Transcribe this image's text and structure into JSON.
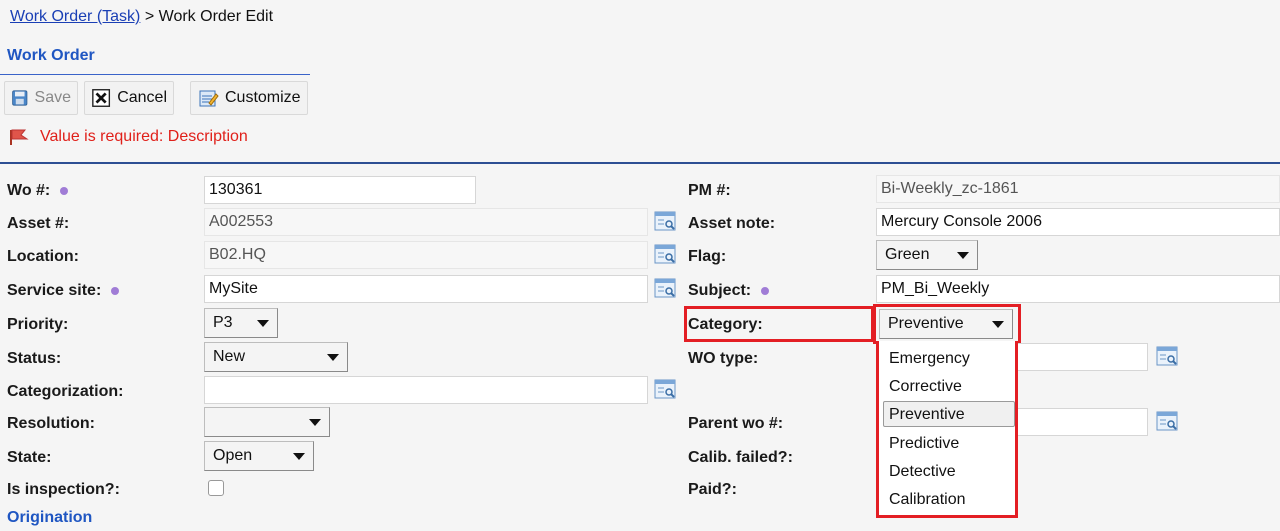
{
  "breadcrumb": {
    "link": "Work Order (Task)",
    "separator": ">",
    "current": "Work Order Edit"
  },
  "section": {
    "title": "Work Order"
  },
  "toolbar": {
    "save": "Save",
    "cancel": "Cancel",
    "customize": "Customize"
  },
  "error": {
    "message": "Value is required: Description"
  },
  "form": {
    "wo_num": {
      "label": "Wo #:",
      "value": "130361"
    },
    "asset_num": {
      "label": "Asset #:",
      "value": "A002553"
    },
    "location": {
      "label": "Location:",
      "value": "B02.HQ"
    },
    "service_site": {
      "label": "Service site:",
      "value": "MySite"
    },
    "priority": {
      "label": "Priority:",
      "value": "P3"
    },
    "status": {
      "label": "Status:",
      "value": "New"
    },
    "categorization": {
      "label": "Categorization:",
      "value": ""
    },
    "resolution": {
      "label": "Resolution:",
      "value": ""
    },
    "state": {
      "label": "State:",
      "value": "Open"
    },
    "is_inspection": {
      "label": "Is inspection?:",
      "checked": false
    },
    "pm_num": {
      "label": "PM #:",
      "value": "Bi-Weekly_zc-1861"
    },
    "asset_note": {
      "label": "Asset note:",
      "value": "Mercury Console 2006"
    },
    "flag": {
      "label": "Flag:",
      "value": "Green"
    },
    "subject": {
      "label": "Subject:",
      "value": "PM_Bi_Weekly"
    },
    "category": {
      "label": "Category:",
      "value": "Preventive",
      "options": [
        "Emergency",
        "Corrective",
        "Preventive",
        "Predictive",
        "Detective",
        "Calibration"
      ]
    },
    "wo_type": {
      "label": "WO type:",
      "value": ""
    },
    "parent_wo": {
      "label": "Parent wo #:",
      "value": ""
    },
    "calib_failed": {
      "label": "Calib. failed?:"
    },
    "paid": {
      "label": "Paid?:"
    }
  },
  "origination": {
    "title": "Origination"
  },
  "colors": {
    "link": "#1a3fb5",
    "section": "#1f56c2",
    "error": "#e0201a",
    "highlight": "#e31e24",
    "required_dot": "#a07cd6"
  }
}
